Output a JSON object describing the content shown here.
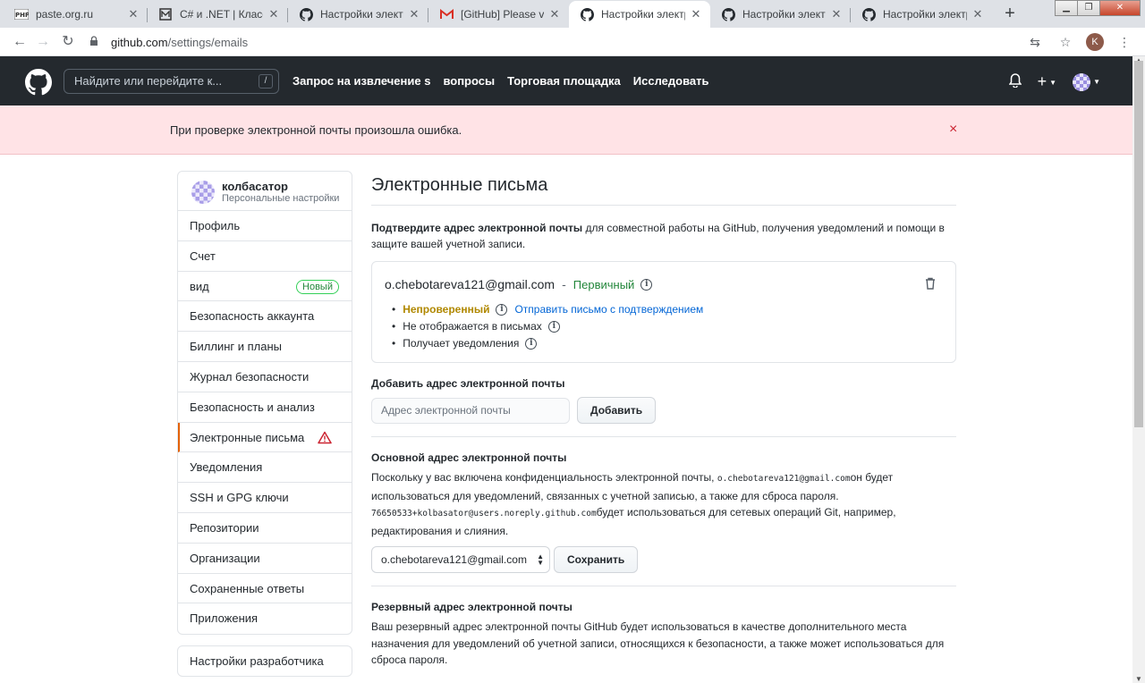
{
  "browser": {
    "tabs": [
      {
        "title": "paste.org.ru",
        "favicon": "php-icon",
        "active": false
      },
      {
        "title": "C# и .NET | Классы и",
        "favicon": "metanit-icon",
        "active": false
      },
      {
        "title": "Настройки электрон",
        "favicon": "github-icon",
        "active": false
      },
      {
        "title": "[GitHub] Please verify",
        "favicon": "gmail-icon",
        "active": false
      },
      {
        "title": "Настройки электрон",
        "favicon": "github-icon",
        "active": true
      },
      {
        "title": "Настройки электрон",
        "favicon": "github-icon",
        "active": false
      },
      {
        "title": "Настройки электрон",
        "favicon": "github-icon",
        "active": false
      }
    ],
    "url_host": "github.com",
    "url_path": "/settings/emails",
    "profile_initial": "K"
  },
  "header": {
    "search_placeholder": "Найдите или перейдите к...",
    "search_shortcut": "/",
    "nav": [
      "Запрос на извлечение s",
      "вопросы",
      "Торговая площадка",
      "Исследовать"
    ]
  },
  "flash": {
    "message": "При проверке электронной почты произошла ошибка.",
    "close": "×"
  },
  "sidebar": {
    "username": "колбасатор",
    "subtitle": "Персональные настройки",
    "items": [
      {
        "label": "Профиль"
      },
      {
        "label": "Счет"
      },
      {
        "label": "вид",
        "badge": "Новый"
      },
      {
        "label": "Безопасность аккаунта"
      },
      {
        "label": "Биллинг и планы"
      },
      {
        "label": "Журнал безопасности"
      },
      {
        "label": "Безопасность и анализ"
      },
      {
        "label": "Электронные письма",
        "selected": true
      },
      {
        "label": "Уведомления"
      },
      {
        "label": "SSH и GPG ключи"
      },
      {
        "label": "Репозитории"
      },
      {
        "label": "Организации"
      },
      {
        "label": "Сохраненные ответы"
      },
      {
        "label": "Приложения"
      }
    ],
    "developer_settings": "Настройки разработчика"
  },
  "main": {
    "title": "Электронные письма",
    "intro_bold": "Подтвердите адрес электронной почты",
    "intro_rest": " для совместной работы на GitHub, получения уведомлений и помощи в защите вашей учетной записи.",
    "email": {
      "address": "o.chebotareva121@gmail.com",
      "dash": "-",
      "primary_label": "Первичный",
      "unverified": "Непроверенный",
      "verify_link": "Отправить письмо с подтверждением",
      "not_shown": "Не отображается в письмах",
      "receives": "Получает уведомления"
    },
    "add": {
      "heading": "Добавить адрес электронной почты",
      "placeholder": "Адрес электронной почты",
      "button": "Добавить"
    },
    "primary": {
      "heading": "Основной адрес электронной почты",
      "text_1": "Поскольку у вас включена конфиденциальность электронной почты, ",
      "mono_1": "o.chebotareva121@gmail.com",
      "text_2": "он будет использоваться для уведомлений, связанных с учетной записью, а также для сброса пароля.",
      "mono_2": "76650533+kolbasator@users.noreply.github.com",
      "text_3": "будет использоваться для сетевых операций Git, например, редактирования и слияния.",
      "selected": "o.chebotareva121@gmail.com",
      "button": "Сохранить"
    },
    "backup": {
      "heading": "Резервный адрес электронной почты",
      "text": "Ваш резервный адрес электронной почты GitHub будет использоваться в качестве дополнительного места назначения для уведомлений об учетной записи, относящихся к безопасности, а также может использоваться для сброса пароля."
    }
  }
}
